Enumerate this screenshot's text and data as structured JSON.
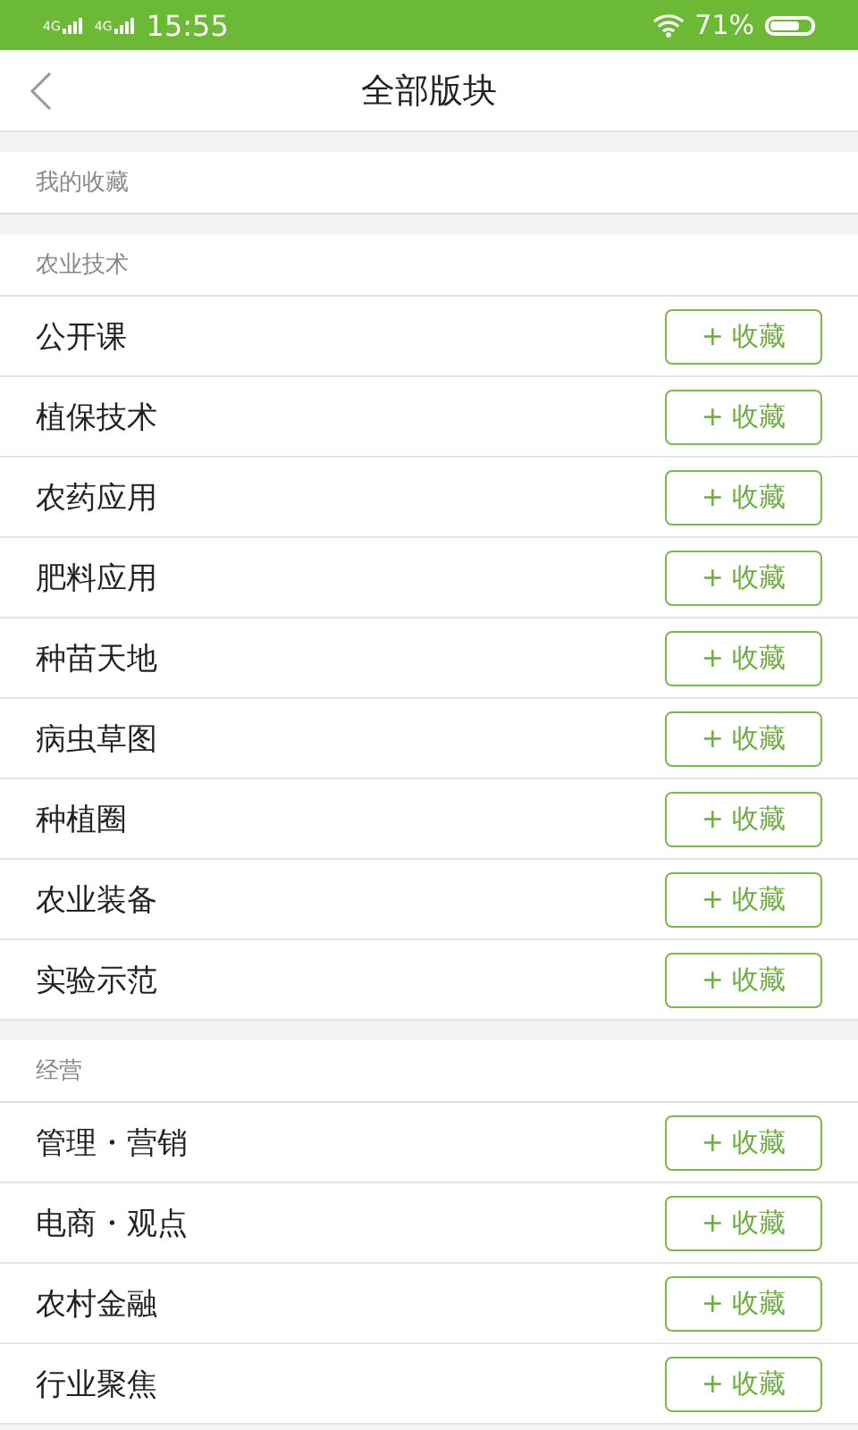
{
  "status_bar": {
    "signal_1": "4G",
    "signal_2": "4G",
    "time": "15:55",
    "battery": "71%"
  },
  "header": {
    "title": "全部版块"
  },
  "sections": [
    {
      "title": "我的收藏"
    },
    {
      "title": "农业技术",
      "items": [
        {
          "name": "公开课",
          "button": "+ 收藏"
        },
        {
          "name": "植保技术",
          "button": "+ 收藏"
        },
        {
          "name": "农药应用",
          "button": "+ 收藏"
        },
        {
          "name": "肥料应用",
          "button": "+ 收藏"
        },
        {
          "name": "种苗天地",
          "button": "+ 收藏"
        },
        {
          "name": "病虫草图",
          "button": "+ 收藏"
        },
        {
          "name": "种植圈",
          "button": "+ 收藏"
        },
        {
          "name": "农业装备",
          "button": "+ 收藏"
        },
        {
          "name": "实验示范",
          "button": "+ 收藏"
        }
      ]
    },
    {
      "title": "经营",
      "items": [
        {
          "name": "管理・营销",
          "button": "+ 收藏"
        },
        {
          "name": "电商・观点",
          "button": "+ 收藏"
        },
        {
          "name": "农村金融",
          "button": "+ 收藏"
        },
        {
          "name": "行业聚焦",
          "button": "+ 收藏"
        }
      ]
    }
  ]
}
